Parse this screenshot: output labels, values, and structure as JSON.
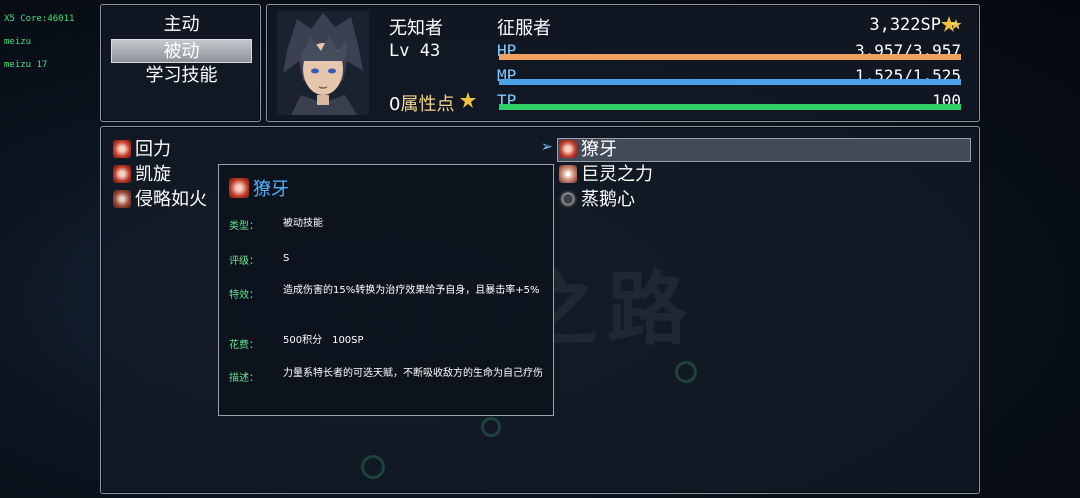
{
  "debug": [
    "X5 Core:46011",
    "meizu",
    "meizu 17"
  ],
  "commands": [
    "主动",
    "被动",
    "学习技能"
  ],
  "commands_selected": 1,
  "actor": {
    "name": "无知者",
    "level_label": "Lv",
    "level": "43",
    "class": "征服者",
    "sp": "3,322SP",
    "attr_points": "0",
    "attr_label": "属性点",
    "hp_label": "HP",
    "hp": "3,957/3,957",
    "hp_ratio": 1.0,
    "mp_label": "MP",
    "mp": "1,525/1,525",
    "mp_ratio": 1.0,
    "tp_label": "TP",
    "tp": "100",
    "tp_ratio": 1.0
  },
  "colors": {
    "hp": "#f0a060",
    "mp": "#4aa2e8",
    "tp": "#2ed06a",
    "label": "#84c9ff",
    "title": "#4fb3ff"
  },
  "skills_left": [
    {
      "name": "回力",
      "icon": "swirl-red-icon"
    },
    {
      "name": "凯旋",
      "icon": "swirl-red-icon"
    },
    {
      "name": "侵略如火",
      "icon": "spiral-icon"
    }
  ],
  "skills_right": [
    {
      "name": "獠牙",
      "icon": "swirl-red-icon"
    },
    {
      "name": "巨灵之力",
      "icon": "burst-icon"
    },
    {
      "name": "蒸鹅心",
      "icon": "circle-dark-icon"
    }
  ],
  "detail": {
    "title": "獠牙",
    "type_label": "类型：",
    "type": "被动技能",
    "grade_label": "评级：",
    "grade": "S",
    "effect_label": "特效：",
    "effect": "造成伤害的15%转换为治疗效果给予自身，且暴击率+5%",
    "cost_label": "花费：",
    "cost": "500积分　100SP",
    "desc_label": "描述：",
    "desc": "力量系特长者的可选天赋，不断吸收敌方的生命为自己疗伤"
  }
}
